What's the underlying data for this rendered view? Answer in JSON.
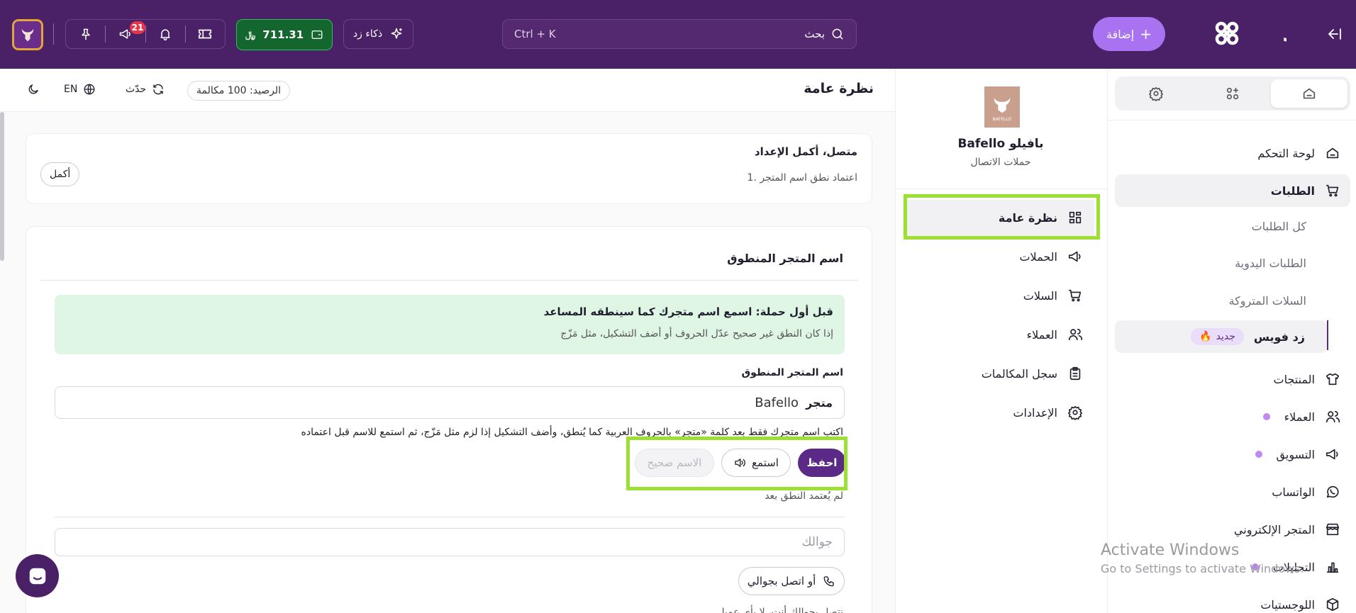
{
  "topbar": {
    "add_label": "إضافة",
    "search_label": "بحث",
    "search_shortcut": "Ctrl + K",
    "ai_label": "ذكاء زد",
    "wallet_amount": "711.31",
    "notif_count": "21",
    "brand_color": "#4a2166",
    "logo_text": "زد"
  },
  "sidebar": {
    "items": [
      {
        "label": "لوحة التحكم",
        "icon": "home-icon"
      },
      {
        "label": "الطلبات",
        "icon": "cart-icon"
      },
      {
        "label": "المنتجات",
        "icon": "shirt-icon"
      },
      {
        "label": "العملاء",
        "icon": "users-icon"
      },
      {
        "label": "التسويق",
        "icon": "megaphone-icon"
      },
      {
        "label": "الواتساب",
        "icon": "whatsapp-icon"
      },
      {
        "label": "المتجر الإلكتروني",
        "icon": "store-icon"
      },
      {
        "label": "التحليلات",
        "icon": "chart-icon"
      },
      {
        "label": "اللوجستيات",
        "icon": "box-icon"
      }
    ],
    "orders_sub": [
      "كل الطلبات",
      "الطلبات اليدوية",
      "السلات المتروكة"
    ],
    "zid_voice": "زد فويس",
    "new_badge": "جديد"
  },
  "campaign": {
    "store_name": "Bafello بافيلو",
    "subtitle": "حملات الاتصال",
    "logo_text": "BAFELLO",
    "menu": [
      {
        "label": "نظرة عامة",
        "icon": "grid-icon"
      },
      {
        "label": "الحملات",
        "icon": "megaphone-icon"
      },
      {
        "label": "السلات",
        "icon": "cart-icon"
      },
      {
        "label": "العملاء",
        "icon": "users-icon"
      },
      {
        "label": "سجل المكالمات",
        "icon": "clipboard-icon"
      },
      {
        "label": "الإعدادات",
        "icon": "gear-icon"
      }
    ]
  },
  "main": {
    "title": "نظرة عامة",
    "balance": "الرصيد: 100 مكالمة",
    "refresh": "حدّث",
    "lang": "EN",
    "setup_title": "متصل، أكمل الإعداد",
    "setup_step": "1. اعتماد نطق اسم المتجر",
    "complete": "أكمل",
    "section_title": "اسم المتجر المنطوق",
    "alert_title": "قبل أول حملة: اسمع اسم متجرك كما سينطقه المساعد",
    "alert_body": "إذا كان النطق غير صحيح عدّل الحروف أو أضف التشكيل، مثل مَزّج",
    "field_label": "اسم المتجر المنطوق",
    "field_prefix": "متجر",
    "field_value": "Bafello",
    "hint": "اكتب اسم متجرك فقط بعد كلمة «متجر» بالحروف العربية كما يُنطق، وأضف التشكيل إذا لزم مثل مَزّج، ثم استمع للاسم قبل اعتماده",
    "save": "احفظ",
    "listen": "استمع",
    "correct": "الاسم صحيح",
    "not_yet": "لم يُعتمد النطق بعد",
    "phone_placeholder": "جوالك",
    "call_me": "أو اتصل بجوالي",
    "cut_text": "نتصل بجوالك أنت، لا بأي عميل"
  },
  "watermark": {
    "line1": "Activate Windows",
    "line2": "Go to Settings to activate Windows."
  }
}
